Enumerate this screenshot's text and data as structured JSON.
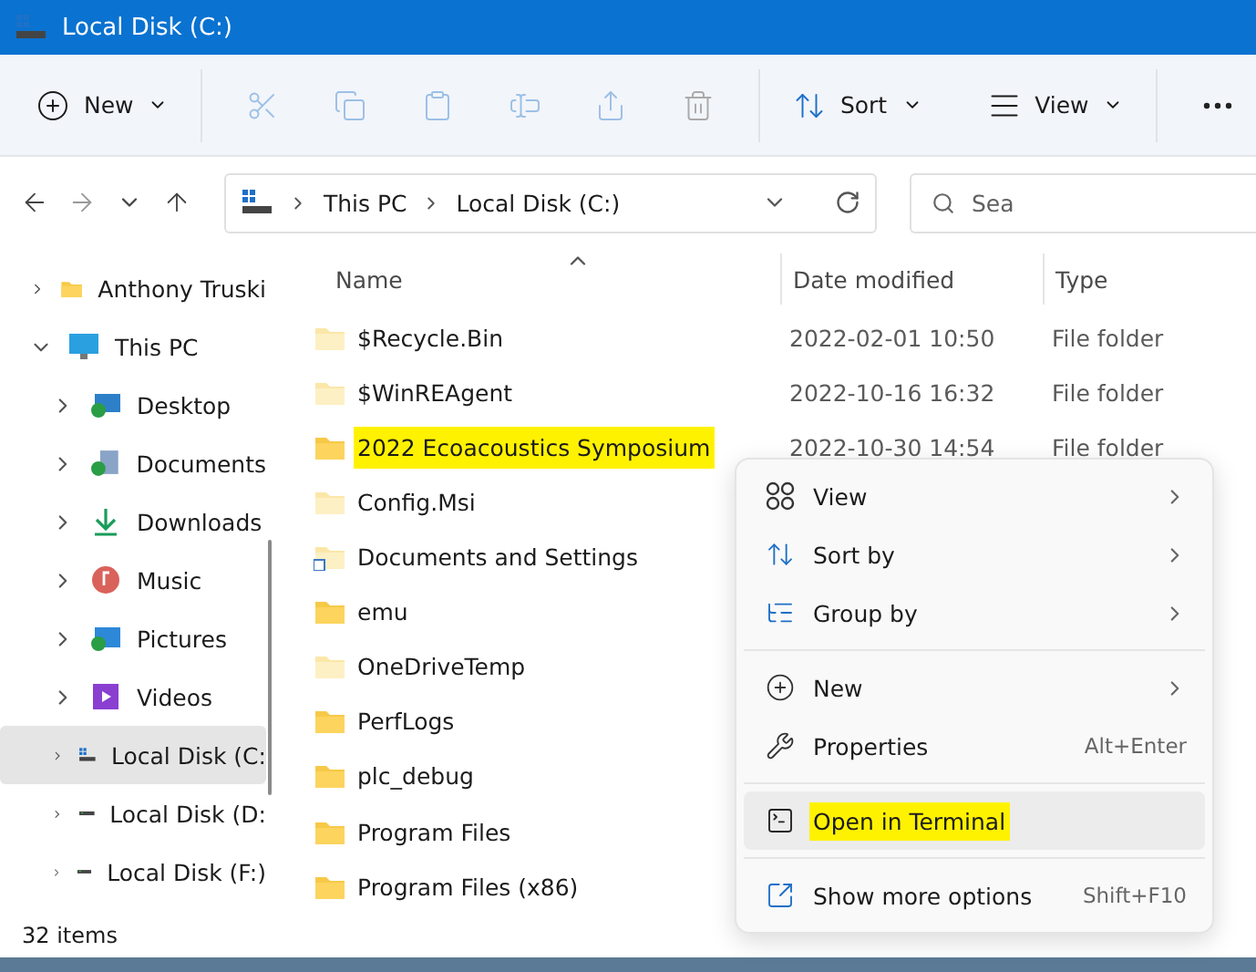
{
  "window": {
    "title": "Local Disk (C:)"
  },
  "toolbar": {
    "new_label": "New",
    "sort_label": "Sort",
    "view_label": "View"
  },
  "address": {
    "crumbs": [
      "This PC",
      "Local Disk (C:)"
    ],
    "search_placeholder": "Sea"
  },
  "sidebar": {
    "items": [
      {
        "label": "Anthony Truski",
        "kind": "folder",
        "expanded": false,
        "selected": false
      },
      {
        "label": "This PC",
        "kind": "computer",
        "expanded": true,
        "selected": false,
        "children": [
          {
            "label": "Desktop",
            "kind": "desktop",
            "expanded": false,
            "selected": false
          },
          {
            "label": "Documents",
            "kind": "documents",
            "expanded": false,
            "selected": false
          },
          {
            "label": "Downloads",
            "kind": "downloads",
            "expanded": false,
            "selected": false
          },
          {
            "label": "Music",
            "kind": "music",
            "expanded": false,
            "selected": false
          },
          {
            "label": "Pictures",
            "kind": "pictures",
            "expanded": false,
            "selected": false
          },
          {
            "label": "Videos",
            "kind": "videos",
            "expanded": false,
            "selected": false
          },
          {
            "label": "Local Disk (C:",
            "kind": "system-drive",
            "expanded": false,
            "selected": true
          },
          {
            "label": "Local Disk (D:",
            "kind": "drive",
            "expanded": false,
            "selected": false
          },
          {
            "label": "Local Disk (F:)",
            "kind": "drive",
            "expanded": false,
            "selected": false
          }
        ]
      }
    ]
  },
  "table": {
    "columns": [
      "Name",
      "Date modified",
      "Type"
    ],
    "rows": [
      {
        "name": "$Recycle.Bin",
        "date": "2022-02-01 10:50",
        "type": "File folder",
        "hidden": true,
        "shortcut": false,
        "highlighted": false
      },
      {
        "name": "$WinREAgent",
        "date": "2022-10-16 16:32",
        "type": "File folder",
        "hidden": true,
        "shortcut": false,
        "highlighted": false
      },
      {
        "name": "2022 Ecoacoustics Symposium",
        "date": "2022-10-30 14:54",
        "type": "File folder",
        "hidden": false,
        "shortcut": false,
        "highlighted": true
      },
      {
        "name": "Config.Msi",
        "hidden": true,
        "shortcut": false,
        "highlighted": false
      },
      {
        "name": "Documents and Settings",
        "hidden": true,
        "shortcut": true,
        "highlighted": false
      },
      {
        "name": "emu",
        "hidden": false,
        "shortcut": false,
        "highlighted": false
      },
      {
        "name": "OneDriveTemp",
        "hidden": true,
        "shortcut": false,
        "highlighted": false
      },
      {
        "name": "PerfLogs",
        "hidden": false,
        "shortcut": false,
        "highlighted": false
      },
      {
        "name": "plc_debug",
        "hidden": false,
        "shortcut": false,
        "highlighted": false
      },
      {
        "name": "Program Files",
        "hidden": false,
        "shortcut": false,
        "highlighted": false
      },
      {
        "name": "Program Files (x86)",
        "hidden": false,
        "shortcut": false,
        "highlighted": false
      }
    ]
  },
  "context_menu": {
    "groups": [
      [
        {
          "label": "View",
          "kind": "view",
          "submenu": true,
          "hovered": false,
          "highlighted": false
        },
        {
          "label": "Sort by",
          "kind": "sort",
          "submenu": true,
          "hovered": false,
          "highlighted": false
        },
        {
          "label": "Group by",
          "kind": "group",
          "submenu": true,
          "hovered": false,
          "highlighted": false
        }
      ],
      [
        {
          "label": "New",
          "kind": "new",
          "submenu": true,
          "hovered": false,
          "highlighted": false
        },
        {
          "label": "Properties",
          "kind": "properties",
          "shortcut": "Alt+Enter",
          "submenu": false,
          "hovered": false,
          "highlighted": false
        }
      ],
      [
        {
          "label": "Open in Terminal",
          "kind": "terminal",
          "submenu": false,
          "hovered": true,
          "highlighted": true
        }
      ],
      [
        {
          "label": "Show more options",
          "kind": "more",
          "shortcut": "Shift+F10",
          "submenu": false,
          "hovered": false,
          "highlighted": false
        }
      ]
    ]
  },
  "status_bar": {
    "count": "32 items"
  }
}
